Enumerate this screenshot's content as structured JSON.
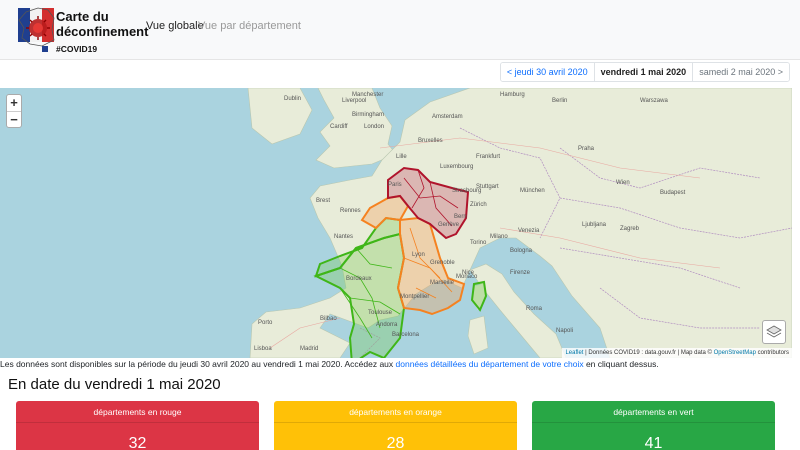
{
  "brand": {
    "title_line1": "Carte du",
    "title_line2": "déconfinement",
    "hashtag": "#COVID19"
  },
  "nav": {
    "active": "Vue globale",
    "inactive": "Vue par département"
  },
  "pager": {
    "prev": "< jeudi 30 avril 2020",
    "current": "vendredi 1 mai 2020",
    "next": "samedi 2 mai 2020 >"
  },
  "map": {
    "zoom_in": "+",
    "zoom_out": "−",
    "attribution": {
      "leaflet": "Leaflet",
      "data": " | Données COVID19 : data.gouv.fr | Map data © ",
      "osm": "OpenStreetMap",
      "contrib": " contributors"
    },
    "colors": {
      "red": "#b0142c",
      "orange": "#f58220",
      "green": "#3fb618"
    },
    "labels": [
      "Dublin",
      "Liverpool",
      "Manchester",
      "Birmingham",
      "Cardiff",
      "London",
      "Amsterdam",
      "Hamburg",
      "Berlin",
      "Bruxelles",
      "Paris",
      "Luxembourg",
      "Frankfurt",
      "Stuttgart",
      "München",
      "Nantes",
      "Bordeaux",
      "Toulouse",
      "Marseille",
      "Lyon",
      "Milano",
      "Roma",
      "Napoli",
      "Praha",
      "Wien",
      "Budapest",
      "Zagreb",
      "Warszawa",
      "Madrid",
      "Barcelona",
      "Bilbao",
      "Porto",
      "Lisboa",
      "Andorra",
      "Monaco",
      "Torino",
      "Venezia",
      "Bologna",
      "Firenze",
      "Ljubljana",
      "Genève",
      "Zürich",
      "Bern",
      "Strasbourg",
      "Lille",
      "Rennes",
      "Brest",
      "Nice",
      "Montpellier",
      "Grenoble"
    ]
  },
  "info": {
    "text_before": "Les données sont disponibles sur la période du jeudi 30 avril 2020 au vendredi 1 mai 2020. Accédez aux ",
    "link": "données détaillées du département de votre choix",
    "text_after": " en cliquant dessus."
  },
  "heading": "En date du vendredi 1 mai 2020",
  "cards": {
    "red": {
      "label": "départements en rouge",
      "count": "32",
      "color": "#dc3545"
    },
    "orange": {
      "label": "départements en orange",
      "count": "28",
      "color": "#ffc107"
    },
    "green": {
      "label": "départements en vert",
      "count": "41",
      "color": "#28a745"
    }
  }
}
